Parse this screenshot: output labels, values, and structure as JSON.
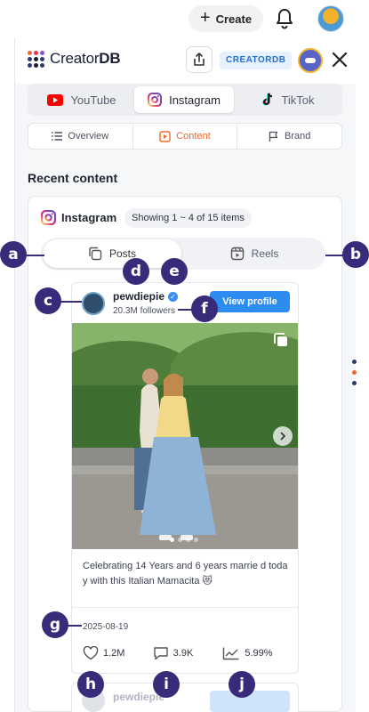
{
  "topbar": {
    "create_label": "Create",
    "icons": [
      "plus-icon",
      "bell-icon",
      "user-avatar"
    ]
  },
  "header": {
    "logo_text_light": "Creator",
    "logo_text_bold": "DB",
    "badge": "CREATORDB",
    "icons": [
      "share-icon",
      "robot-avatar",
      "close-icon"
    ],
    "logo_dot_colors": [
      "#f0682a",
      "#e8395a",
      "#8a4fd1",
      "#2c3e70",
      "#1a1f36",
      "#2c3e70",
      "#2c3e70",
      "#1a1f36",
      "#2c3e70"
    ]
  },
  "platform_tabs": [
    {
      "label": "YouTube",
      "icon": "youtube-icon",
      "active": false
    },
    {
      "label": "Instagram",
      "icon": "instagram-icon",
      "active": true
    },
    {
      "label": "TikTok",
      "icon": "tiktok-icon",
      "active": false
    }
  ],
  "sub_tabs": [
    {
      "label": "Overview",
      "icon": "list-icon",
      "active": false
    },
    {
      "label": "Content",
      "icon": "play-square-icon",
      "active": true
    },
    {
      "label": "Brand",
      "icon": "flag-icon",
      "active": false
    }
  ],
  "section_title": "Recent content",
  "content_card": {
    "platform_name": "Instagram",
    "showing_text": "Showing 1 ~ 4 of 15 items",
    "media_tabs": [
      {
        "label": "Posts",
        "icon": "copy-icon",
        "active": true
      },
      {
        "label": "Reels",
        "icon": "reel-icon",
        "active": false
      }
    ]
  },
  "post": {
    "username": "pewdiepie",
    "verified": true,
    "followers": "20.3M followers",
    "view_profile": "View profile",
    "caption": "Celebrating 14 Years and 6 years marrie d today with this Italian Mamacita 😻",
    "date": "2025-08-19",
    "likes": "1.2M",
    "comments": "3.9K",
    "engagement": "5.99%",
    "carousel_dots": 4,
    "active_dot": 0
  },
  "next_post_peek": {
    "username": "pewdiepie"
  },
  "callouts": [
    "a",
    "b",
    "c",
    "d",
    "e",
    "f",
    "g",
    "h",
    "i",
    "j"
  ],
  "colors": {
    "accent_orange": "#f0682a",
    "primary_blue": "#2d8cf0",
    "callout": "#3a2a7a"
  }
}
